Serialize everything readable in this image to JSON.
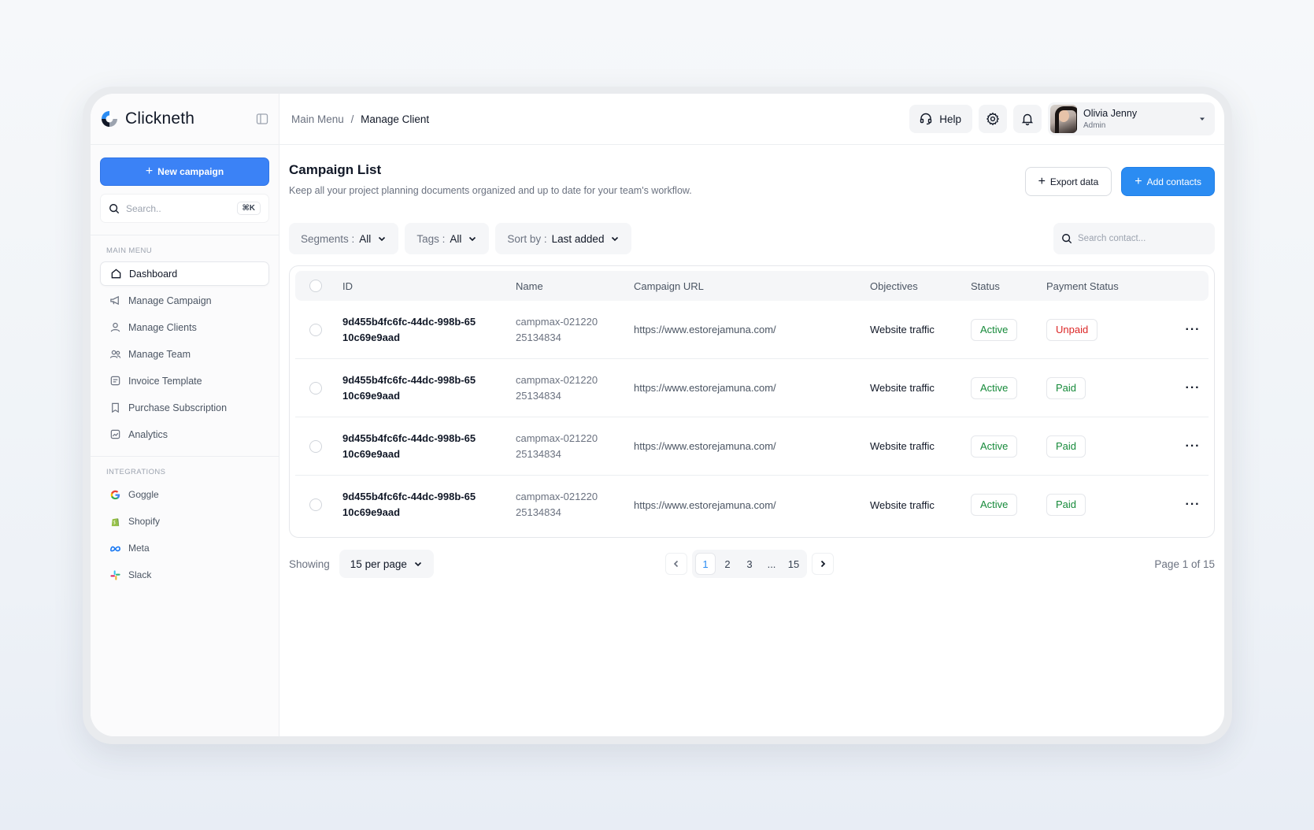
{
  "app": {
    "name": "Clickneth"
  },
  "sidebar": {
    "new_campaign_label": "New campaign",
    "search_placeholder": "Search..",
    "search_shortcut": "⌘K",
    "main_menu_label": "MAIN MENU",
    "items": [
      {
        "label": "Dashboard",
        "icon": "home-icon",
        "active": true
      },
      {
        "label": "Manage Campaign",
        "icon": "megaphone-icon"
      },
      {
        "label": "Manage Clients",
        "icon": "user-icon"
      },
      {
        "label": "Manage Team",
        "icon": "users-icon"
      },
      {
        "label": "Invoice Template",
        "icon": "invoice-icon"
      },
      {
        "label": "Purchase Subscription",
        "icon": "bookmark-icon"
      },
      {
        "label": "Analytics",
        "icon": "chart-icon"
      }
    ],
    "integrations_label": "INTEGRATIONS",
    "integrations": [
      {
        "label": "Goggle",
        "icon": "google-icon"
      },
      {
        "label": "Shopify",
        "icon": "shopify-icon"
      },
      {
        "label": "Meta",
        "icon": "meta-icon"
      },
      {
        "label": "Slack",
        "icon": "slack-icon"
      }
    ]
  },
  "topbar": {
    "breadcrumb_root": "Main Menu",
    "breadcrumb_sep": "/",
    "breadcrumb_current": "Manage Client",
    "help_label": "Help",
    "user_name": "Olivia Jenny",
    "user_role": "Admin"
  },
  "page": {
    "title": "Campaign List",
    "subtitle": "Keep all your project planning documents organized and up to date for your team's workflow.",
    "export_label": "Export data",
    "add_label": "Add contacts"
  },
  "filters": {
    "segments_label": "Segments :",
    "segments_value": "All",
    "tags_label": "Tags :",
    "tags_value": "All",
    "sort_label": "Sort by :",
    "sort_value": "Last added",
    "search_placeholder": "Search contact..."
  },
  "table": {
    "columns": [
      "ID",
      "Name",
      "Campaign URL",
      "Objectives",
      "Status",
      "Payment Status"
    ],
    "rows": [
      {
        "id_l1": "9d455b4fc6fc-44dc-998b-65",
        "id_l2": "10c69e9aad",
        "name_l1": "campmax-021220",
        "name_l2": "25134834",
        "url": "https://www.estorejamuna.com/",
        "objective": "Website traffic",
        "status": "Active",
        "payment": "Unpaid"
      },
      {
        "id_l1": "9d455b4fc6fc-44dc-998b-65",
        "id_l2": "10c69e9aad",
        "name_l1": "campmax-021220",
        "name_l2": "25134834",
        "url": "https://www.estorejamuna.com/",
        "objective": "Website traffic",
        "status": "Active",
        "payment": "Paid"
      },
      {
        "id_l1": "9d455b4fc6fc-44dc-998b-65",
        "id_l2": "10c69e9aad",
        "name_l1": "campmax-021220",
        "name_l2": "25134834",
        "url": "https://www.estorejamuna.com/",
        "objective": "Website traffic",
        "status": "Active",
        "payment": "Paid"
      },
      {
        "id_l1": "9d455b4fc6fc-44dc-998b-65",
        "id_l2": "10c69e9aad",
        "name_l1": "campmax-021220",
        "name_l2": "25134834",
        "url": "https://www.estorejamuna.com/",
        "objective": "Website traffic",
        "status": "Active",
        "payment": "Paid"
      }
    ],
    "more_label": "···"
  },
  "pagination": {
    "showing_label": "Showing",
    "per_page": "15 per page",
    "pages": [
      "1",
      "2",
      "3",
      "...",
      "15"
    ],
    "current": "1",
    "page_info": "Page 1 of 15"
  },
  "colors": {
    "primary": "#2b8cf2",
    "status_green": "#168a3a",
    "status_red": "#dc2626"
  }
}
